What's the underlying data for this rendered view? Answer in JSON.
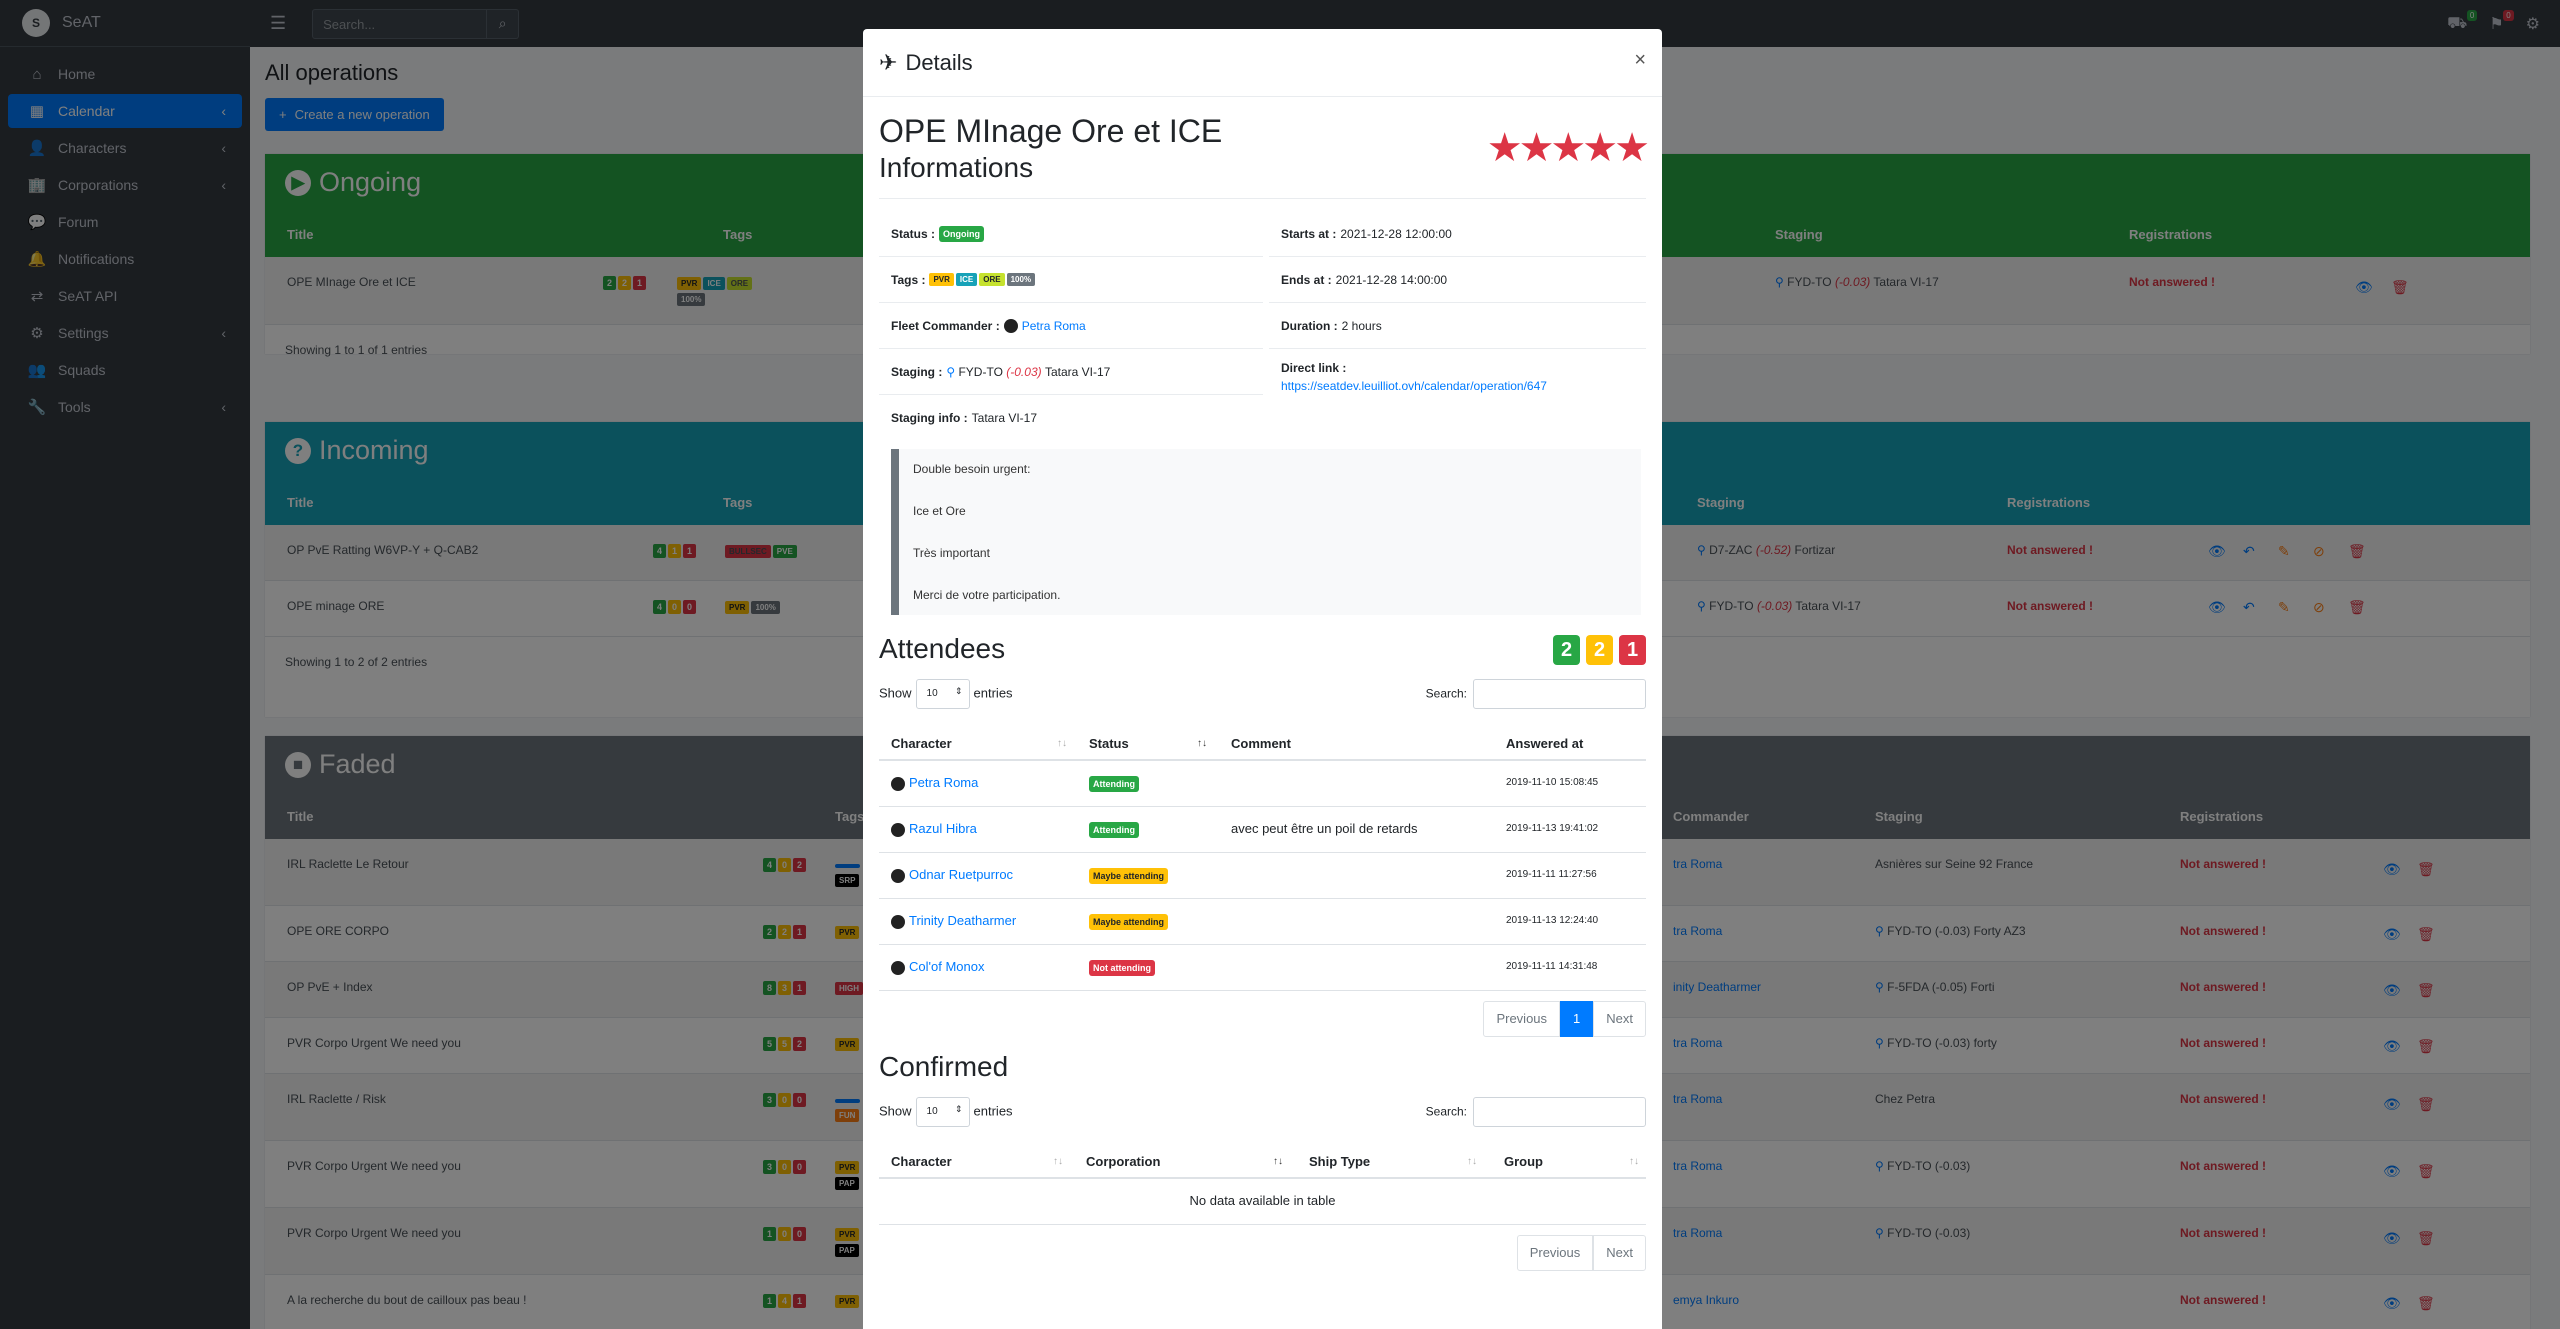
{
  "app": {
    "brand": "SeAT",
    "logo_text": "S"
  },
  "sidebar": {
    "items": [
      {
        "label": "Home",
        "icon": "⌂"
      },
      {
        "label": "Calendar",
        "icon": "▦"
      },
      {
        "label": "Characters",
        "icon": "👤"
      },
      {
        "label": "Corporations",
        "icon": "🏢"
      },
      {
        "label": "Forum",
        "icon": "💬"
      },
      {
        "label": "Notifications",
        "icon": "🔔"
      },
      {
        "label": "SeAT API",
        "icon": "⇄"
      },
      {
        "label": "Settings",
        "icon": "⚙"
      },
      {
        "label": "Squads",
        "icon": "👥"
      },
      {
        "label": "Tools",
        "icon": "🔧"
      }
    ]
  },
  "topbar": {
    "search_placeholder": "Search...",
    "badge_1": "0",
    "badge_2": "0"
  },
  "main": {
    "page_title": "All operations",
    "create_label": "Create a new operation",
    "ongoing": {
      "title": "Ongoing",
      "cols": {
        "title": "Title",
        "tags": "Tags",
        "staging": "Staging",
        "registrations": "Registrations"
      },
      "rows": [
        {
          "title": "OPE MInage Ore et ICE",
          "counts": [
            "2",
            "2",
            "1"
          ],
          "tags": [
            "PVR",
            "ICE",
            "ORE",
            "100%"
          ],
          "staging_sys": "FYD-TO",
          "staging_sec": "(-0.03)",
          "staging_loc": "Tatara VI-17",
          "reg": "Not answered !"
        }
      ],
      "showing": "Showing 1 to 1 of 1 entries"
    },
    "incoming": {
      "title": "Incoming",
      "cols": {
        "title": "Title",
        "tags": "Tags",
        "staging": "Staging",
        "registrations": "Registrations"
      },
      "rows": [
        {
          "title": "OP PvE Ratting W6VP-Y + Q-CAB2",
          "counts": [
            "4",
            "1",
            "1"
          ],
          "tags": [
            "BULLSEC",
            "PVE"
          ],
          "staging_sys": "D7-ZAC",
          "staging_sec": "(-0.52)",
          "staging_loc": "Fortizar",
          "reg": "Not answered !"
        },
        {
          "title": "OPE minage ORE",
          "counts": [
            "4",
            "0",
            "0"
          ],
          "tags": [
            "PVR",
            "100%"
          ],
          "staging_sys": "FYD-TO",
          "staging_sec": "(-0.03)",
          "staging_loc": "Tatara VI-17",
          "reg": "Not answered !"
        }
      ],
      "showing": "Showing 1 to 2 of 2 entries"
    },
    "faded": {
      "title": "Faded",
      "cols": {
        "title": "Title",
        "tags": "Tags",
        "commander": "Commander",
        "staging": "Staging",
        "registrations": "Registrations"
      },
      "rows": [
        {
          "title": "IRL Raclette Le Retour",
          "counts": [
            "4",
            "0",
            "2"
          ],
          "tags": [
            "",
            "SRP"
          ],
          "commander": "tra Roma",
          "staging": "Asnières sur Seine 92 France",
          "reg": "Not answered !"
        },
        {
          "title": "OPE ORE CORPO",
          "counts": [
            "2",
            "2",
            "1"
          ],
          "tags": [
            "PVR"
          ],
          "commander": "tra Roma",
          "staging": "FYD-TO (-0.03) Forty AZ3",
          "reg": "Not answered !"
        },
        {
          "title": "OP PvE + Index",
          "counts": [
            "8",
            "3",
            "1"
          ],
          "tags": [
            "HIGH"
          ],
          "commander": "inity Deatharmer",
          "staging": "F-5FDA (-0.05) Forti",
          "reg": "Not answered !"
        },
        {
          "title": "PVR Corpo Urgent We need you",
          "counts": [
            "5",
            "5",
            "2"
          ],
          "tags": [
            "PVR"
          ],
          "commander": "tra Roma",
          "staging": "FYD-TO (-0.03) forty",
          "reg": "Not answered !"
        },
        {
          "title": "IRL Raclette / Risk",
          "counts": [
            "3",
            "0",
            "0"
          ],
          "tags": [
            "",
            "FUN"
          ],
          "commander": "tra Roma",
          "staging": "Chez Petra",
          "reg": "Not answered !"
        },
        {
          "title": "PVR Corpo Urgent We need you",
          "counts": [
            "3",
            "0",
            "0"
          ],
          "tags": [
            "PVR",
            "PAP"
          ],
          "commander": "tra Roma",
          "staging": "FYD-TO (-0.03)",
          "reg": "Not answered !"
        },
        {
          "title": "PVR Corpo Urgent We need you",
          "counts": [
            "1",
            "0",
            "0"
          ],
          "tags": [
            "PVR",
            "PAP"
          ],
          "commander": "tra Roma",
          "staging": "FYD-TO (-0.03)",
          "reg": "Not answered !"
        },
        {
          "title": "A la recherche du bout de cailloux pas beau !",
          "counts": [
            "1",
            "4",
            "1"
          ],
          "tags": [
            "PVR"
          ],
          "commander": "emya Inkuro",
          "staging": "",
          "reg": "Not answered !"
        }
      ]
    }
  },
  "modal": {
    "header": "Details",
    "close": "×",
    "op_title": "OPE MInage Ore et ICE",
    "stars": "★★★★★",
    "info_title": "Informations",
    "status_label": "Status :",
    "status_value": "Ongoing",
    "starts_label": "Starts at :",
    "starts_value": "2021-12-28 12:00:00",
    "tags_label": "Tags :",
    "tags": [
      "PVR",
      "ICE",
      "ORE",
      "100%"
    ],
    "ends_label": "Ends at :",
    "ends_value": "2021-12-28 14:00:00",
    "fc_label": "Fleet Commander :",
    "fc_value": "Petra Roma",
    "duration_label": "Duration :",
    "duration_value": "2 hours",
    "staging_label": "Staging :",
    "staging_sys": "FYD-TO",
    "staging_sec": "(-0.03)",
    "staging_loc": "Tatara VI-17",
    "direct_label": "Direct link :",
    "direct_value": "https://seatdev.leuilliot.ovh/calendar/operation/647",
    "staginginfo_label": "Staging info :",
    "staginginfo_value": "Tatara VI-17",
    "description": [
      "Double besoin urgent:",
      "Ice et Ore",
      "Très important",
      "Merci de votre participation."
    ],
    "attendees_title": "Attendees",
    "counters": [
      "2",
      "2",
      "1"
    ],
    "show": "Show",
    "entries": "entries",
    "len": "10",
    "search_label": "Search:",
    "att_cols": [
      "Character",
      "Status",
      "Comment",
      "Answered at"
    ],
    "attendees": [
      {
        "name": "Petra Roma",
        "status": "Attending",
        "comment": "",
        "at": "2019-11-10 15:08:45"
      },
      {
        "name": "Razul Hibra",
        "status": "Attending",
        "comment": "avec peut être un poil de retards",
        "at": "2019-11-13 19:41:02"
      },
      {
        "name": "Odnar Ruetpurroc",
        "status": "Maybe attending",
        "comment": "",
        "at": "2019-11-11 11:27:56"
      },
      {
        "name": "Trinity Deatharmer",
        "status": "Maybe attending",
        "comment": "",
        "at": "2019-11-13 12:24:40"
      },
      {
        "name": "Col'of Monox",
        "status": "Not attending",
        "comment": "",
        "at": "2019-11-11 14:31:48"
      }
    ],
    "prev": "Previous",
    "page": "1",
    "next": "Next",
    "confirmed_title": "Confirmed",
    "conf_cols": [
      "Character",
      "Corporation",
      "Ship Type",
      "Group"
    ],
    "no_data": "No data available in table"
  }
}
